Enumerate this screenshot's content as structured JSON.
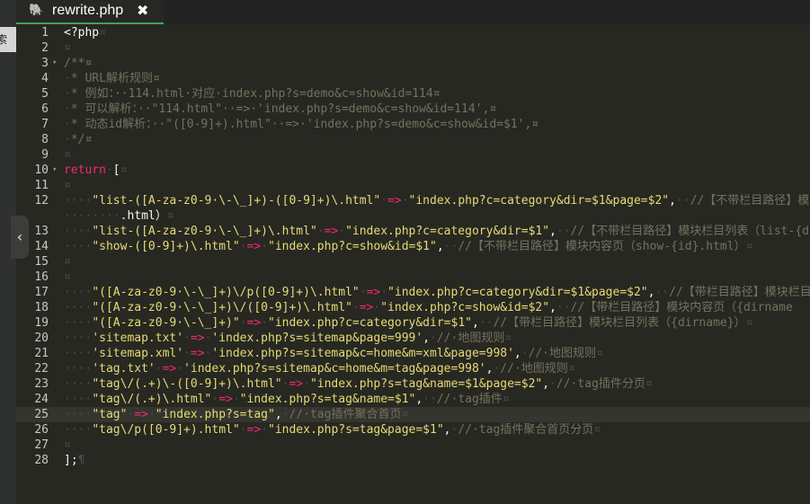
{
  "sidebar": {
    "button_label": "索"
  },
  "tab": {
    "icon": "php-elephant-icon",
    "title": "rewrite.php",
    "close_glyph": "✖"
  },
  "collapse_handle": {
    "glyph": "‹"
  },
  "editor": {
    "current_line": 25,
    "lines": [
      {
        "n": "1",
        "fold": "",
        "code": "<?php¤"
      },
      {
        "n": "2",
        "fold": "",
        "code": "¤"
      },
      {
        "n": "3",
        "fold": "▾",
        "code": "/**¤"
      },
      {
        "n": "4",
        "fold": "",
        "code": "·* URL解析规则¤"
      },
      {
        "n": "5",
        "fold": "",
        "code": "·* 例如：··114.html·对应·index.php?s=demo&c=show&id=114¤"
      },
      {
        "n": "6",
        "fold": "",
        "code": "·* 可以解析：··\"114.html\"··=>·'index.php?s=demo&c=show&id=114',¤"
      },
      {
        "n": "7",
        "fold": "",
        "code": "·* 动态id解析：··\"([0-9]+).html\"··=>·'index.php?s=demo&c=show&id=$1',¤"
      },
      {
        "n": "8",
        "fold": "",
        "code": "·*/¤"
      },
      {
        "n": "9",
        "fold": "",
        "code": "¤"
      },
      {
        "n": "10",
        "fold": "▾",
        "code": "return·[¤"
      },
      {
        "n": "11",
        "fold": "",
        "code": "¤"
      },
      {
        "n": "12",
        "fold": "",
        "code": "····\"list-([A-za-z0-9·\\-\\_]+)-([0-9]+)\\.html\"·=>·\"index.php?c=category&dir=$1&page=$2\",··//【不带栏目路径】模块栏"
      },
      {
        "n": "",
        "fold": "",
        "code": "········.html）¤"
      },
      {
        "n": "13",
        "fold": "",
        "code": "····\"list-([A-za-z0-9·\\-\\_]+)\\.html\"·=>·\"index.php?c=category&dir=$1\",··//【不带栏目路径】模块栏目列表（list-{d"
      },
      {
        "n": "14",
        "fold": "",
        "code": "····\"show-([0-9]+)\\.html\"·=>·\"index.php?c=show&id=$1\",··//【不带栏目路径】模块内容页（show-{id}.html）¤"
      },
      {
        "n": "15",
        "fold": "",
        "code": "¤"
      },
      {
        "n": "16",
        "fold": "",
        "code": "¤"
      },
      {
        "n": "17",
        "fold": "",
        "code": "····\"([A-za-z0-9·\\-\\_]+)\\/p([0-9]+)\\.html\"·=>·\"index.php?c=category&dir=$1&page=$2\",··//【带栏目路径】模块栏目"
      },
      {
        "n": "18",
        "fold": "",
        "code": "····\"([A-za-z0-9·\\-\\_]+)\\/([0-9]+)\\.html\"·=>·\"index.php?c=show&id=$2\",··//【带栏目路径】模块内容页（{dirname"
      },
      {
        "n": "19",
        "fold": "",
        "code": "····\"([A-za-z0-9·\\-\\_]+)\"·=>·\"index.php?c=category&dir=$1\",··//【带栏目路径】模块栏目列表（{dirname}）¤"
      },
      {
        "n": "20",
        "fold": "",
        "code": "····'sitemap.txt'·=>·'index.php?s=sitemap&page=999',·//·地图规则¤"
      },
      {
        "n": "21",
        "fold": "",
        "code": "····'sitemap.xml'·=>·'index.php?s=sitemap&c=home&m=xml&page=998',·//·地图规则¤"
      },
      {
        "n": "22",
        "fold": "",
        "code": "····'tag.txt'·=>·'index.php?s=sitemap&c=home&m=tag&page=998',·//·地图规则¤"
      },
      {
        "n": "23",
        "fold": "",
        "code": "····\"tag\\/(.+)\\-([0-9]+)\\.html\"·=>·\"index.php?s=tag&name=$1&page=$2\",·//·tag插件分页¤"
      },
      {
        "n": "24",
        "fold": "",
        "code": "····\"tag\\/(.+)\\.html\"·=>·\"index.php?s=tag&name=$1\",··//·tag插件¤"
      },
      {
        "n": "25",
        "fold": "",
        "code": "····\"tag\"·=>·\"index.php?s=tag\",·//·tag插件聚合首页¤"
      },
      {
        "n": "26",
        "fold": "",
        "code": "····\"tag\\/p([0-9]+).html\"·=>·\"index.php?s=tag&page=$1\",·//·tag插件聚合首页分页¤"
      },
      {
        "n": "27",
        "fold": "",
        "code": "¤"
      },
      {
        "n": "28",
        "fold": "",
        "code": "];¶"
      }
    ]
  }
}
